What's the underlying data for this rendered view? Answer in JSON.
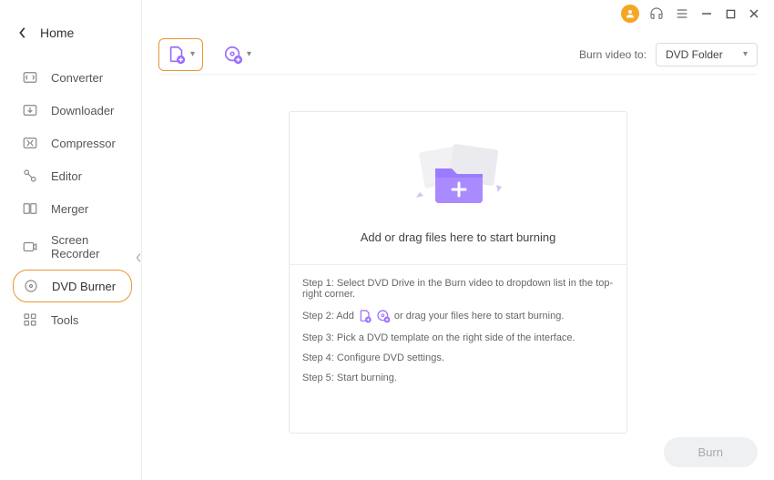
{
  "sidebar": {
    "title": "Home",
    "items": [
      {
        "label": "Converter"
      },
      {
        "label": "Downloader"
      },
      {
        "label": "Compressor"
      },
      {
        "label": "Editor"
      },
      {
        "label": "Merger"
      },
      {
        "label": "Screen Recorder"
      },
      {
        "label": "DVD Burner"
      },
      {
        "label": "Tools"
      }
    ]
  },
  "toolbar": {
    "burn_label": "Burn video to:",
    "burn_target": "DVD Folder"
  },
  "dropzone": {
    "text": "Add or drag files here to start burning"
  },
  "steps": {
    "s1": "Step 1: Select DVD Drive in the Burn video to dropdown list in the top-right corner.",
    "s2a": "Step 2: Add",
    "s2b": "or drag your files here to start burning.",
    "s3": "Step 3: Pick a DVD template on the right side of the interface.",
    "s4": "Step 4: Configure DVD settings.",
    "s5": "Step 5: Start burning."
  },
  "footer": {
    "burn": "Burn"
  }
}
